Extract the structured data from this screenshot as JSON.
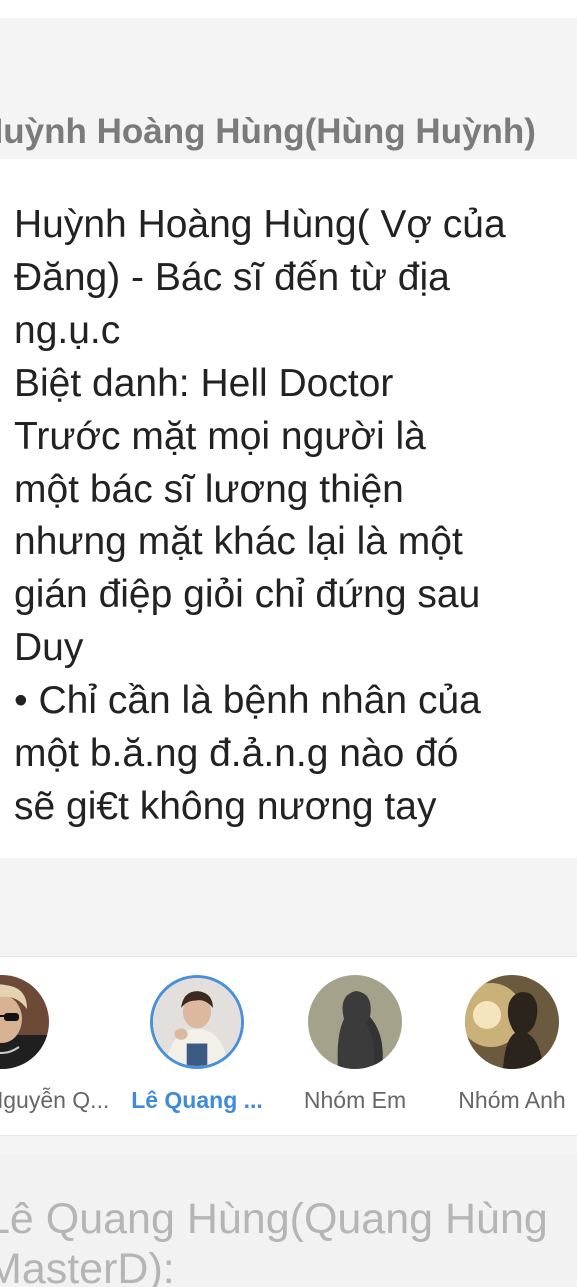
{
  "header": {
    "title": "Huỳnh Hoàng Hùng(Hùng Huỳnh)"
  },
  "description": {
    "lines": [
      "Huỳnh Hoàng Hùng( Vợ của",
      "Đăng) - Bác sĩ đến từ địa",
      "ng.ụ.c",
      "Biệt danh: Hell Doctor",
      "Trước mặt mọi người là",
      "một bác sĩ lương thiện",
      "nhưng mặt khác lại là một",
      "gián điệp giỏi chỉ đứng sau",
      "Duy",
      "• Chỉ cần là bệnh nhân của",
      "một b.ă.ng đ.ả.n.g nào đó",
      "sẽ gi€t không nương tay"
    ]
  },
  "characters": [
    {
      "name": "Nguyễn Q...",
      "icon": "avatar-photo-man-sunglasses",
      "selected": false
    },
    {
      "name": "Lê Quang ...",
      "icon": "avatar-photo-man-white-jacket",
      "selected": true
    },
    {
      "name": "Nhóm Em",
      "icon": "silhouette-woman-icon",
      "selected": false
    },
    {
      "name": "Nhóm Anh",
      "icon": "silhouette-man-icon",
      "selected": false
    }
  ],
  "next_section": {
    "lines": [
      "Lê Quang Hùng(Quang Hùng",
      "MasterD):"
    ]
  },
  "colors": {
    "selected_accent": "#3d8bd9",
    "muted_text": "#7b7b7b",
    "body_text": "#222222"
  }
}
